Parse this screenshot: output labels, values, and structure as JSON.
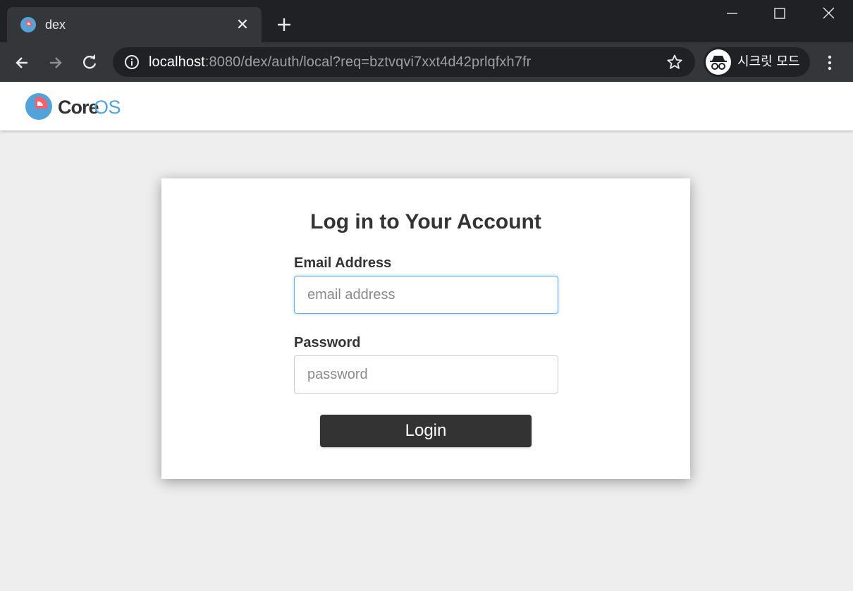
{
  "browser": {
    "tab": {
      "title": "dex",
      "close_glyph": "✕"
    },
    "url": {
      "host": "localhost",
      "rest": ":8080/dex/auth/local?req=bztvqvi7xxt4d42prlqfxh7fr"
    },
    "incognito_label": "시크릿 모드",
    "icons": [
      "dex-favicon-icon",
      "close-icon",
      "plus-icon",
      "minimize-icon",
      "maximize-icon",
      "window-close-icon",
      "back-arrow-icon",
      "forward-arrow-icon",
      "reload-icon",
      "info-icon",
      "star-icon",
      "incognito-icon",
      "more-vertical-icon"
    ]
  },
  "header": {
    "logo": {
      "core": "Core",
      "os": "OS"
    }
  },
  "login": {
    "title": "Log in to Your Account",
    "email_label": "Email Address",
    "email_placeholder": "email address",
    "email_value": "",
    "password_label": "Password",
    "password_placeholder": "password",
    "password_value": "",
    "submit_label": "Login"
  },
  "colors": {
    "chrome_dark": "#202124",
    "chrome_tab": "#35363a",
    "page_bg": "#eeeeee",
    "button_bg": "#333333",
    "focus_border": "#66afe9",
    "logo_blue": "#53a3da",
    "logo_red": "#f1616f"
  }
}
